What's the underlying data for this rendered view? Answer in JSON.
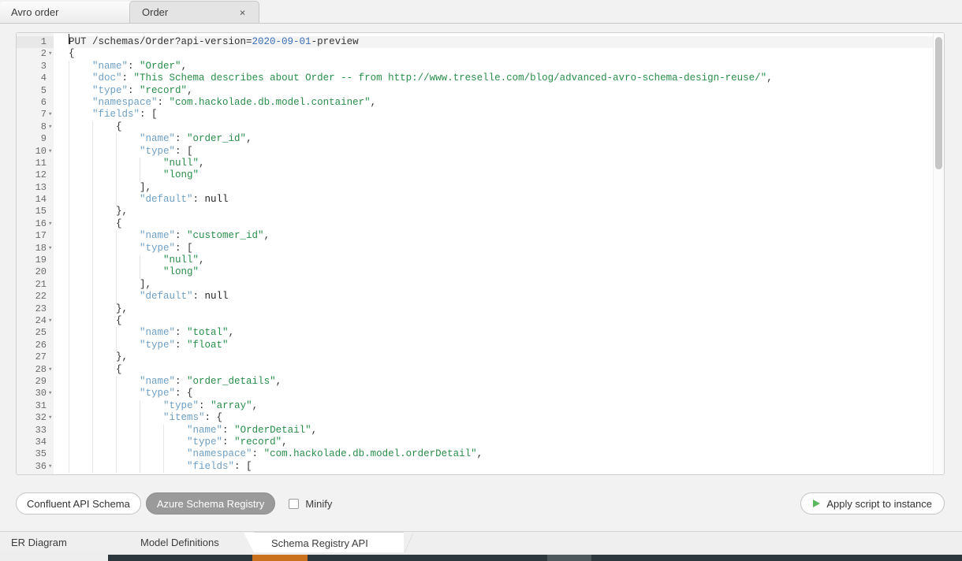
{
  "top_tabs": [
    {
      "label": "Avro order",
      "active": false,
      "closable": false
    },
    {
      "label": "Order",
      "active": true,
      "closable": true,
      "close_glyph": "×"
    }
  ],
  "editor": {
    "language": "json",
    "cursor_line": 1,
    "first_visible_line": 1,
    "lines": [
      {
        "num": "1",
        "fold": "",
        "guides": 0,
        "active": true,
        "tokens": [
          {
            "t": "PUT /schemas/Order?api-version=",
            "c": "p"
          },
          {
            "t": "2020-09-01",
            "c": "n"
          },
          {
            "t": "-preview",
            "c": "p"
          }
        ]
      },
      {
        "num": "2",
        "fold": "▾",
        "guides": 0,
        "tokens": [
          {
            "t": "{",
            "c": "p"
          }
        ]
      },
      {
        "num": "3",
        "fold": "",
        "guides": 1,
        "tokens": [
          {
            "t": "    ",
            "c": "p"
          },
          {
            "t": "\"name\"",
            "c": "k"
          },
          {
            "t": ": ",
            "c": "p"
          },
          {
            "t": "\"Order\"",
            "c": "s"
          },
          {
            "t": ",",
            "c": "p"
          }
        ]
      },
      {
        "num": "4",
        "fold": "",
        "guides": 1,
        "tokens": [
          {
            "t": "    ",
            "c": "p"
          },
          {
            "t": "\"doc\"",
            "c": "k"
          },
          {
            "t": ": ",
            "c": "p"
          },
          {
            "t": "\"This Schema describes about Order -- from http://www.treselle.com/blog/advanced-avro-schema-design-reuse/\"",
            "c": "s"
          },
          {
            "t": ",",
            "c": "p"
          }
        ]
      },
      {
        "num": "5",
        "fold": "",
        "guides": 1,
        "tokens": [
          {
            "t": "    ",
            "c": "p"
          },
          {
            "t": "\"type\"",
            "c": "k"
          },
          {
            "t": ": ",
            "c": "p"
          },
          {
            "t": "\"record\"",
            "c": "s"
          },
          {
            "t": ",",
            "c": "p"
          }
        ]
      },
      {
        "num": "6",
        "fold": "",
        "guides": 1,
        "tokens": [
          {
            "t": "    ",
            "c": "p"
          },
          {
            "t": "\"namespace\"",
            "c": "k"
          },
          {
            "t": ": ",
            "c": "p"
          },
          {
            "t": "\"com.hackolade.db.model.container\"",
            "c": "s"
          },
          {
            "t": ",",
            "c": "p"
          }
        ]
      },
      {
        "num": "7",
        "fold": "▾",
        "guides": 1,
        "tokens": [
          {
            "t": "    ",
            "c": "p"
          },
          {
            "t": "\"fields\"",
            "c": "k"
          },
          {
            "t": ": [",
            "c": "p"
          }
        ]
      },
      {
        "num": "8",
        "fold": "▾",
        "guides": 2,
        "tokens": [
          {
            "t": "        {",
            "c": "p"
          }
        ]
      },
      {
        "num": "9",
        "fold": "",
        "guides": 3,
        "tokens": [
          {
            "t": "            ",
            "c": "p"
          },
          {
            "t": "\"name\"",
            "c": "k"
          },
          {
            "t": ": ",
            "c": "p"
          },
          {
            "t": "\"order_id\"",
            "c": "s"
          },
          {
            "t": ",",
            "c": "p"
          }
        ]
      },
      {
        "num": "10",
        "fold": "▾",
        "guides": 3,
        "tokens": [
          {
            "t": "            ",
            "c": "p"
          },
          {
            "t": "\"type\"",
            "c": "k"
          },
          {
            "t": ": [",
            "c": "p"
          }
        ]
      },
      {
        "num": "11",
        "fold": "",
        "guides": 4,
        "tokens": [
          {
            "t": "                ",
            "c": "p"
          },
          {
            "t": "\"null\"",
            "c": "s"
          },
          {
            "t": ",",
            "c": "p"
          }
        ]
      },
      {
        "num": "12",
        "fold": "",
        "guides": 4,
        "tokens": [
          {
            "t": "                ",
            "c": "p"
          },
          {
            "t": "\"long\"",
            "c": "s"
          }
        ]
      },
      {
        "num": "13",
        "fold": "",
        "guides": 3,
        "tokens": [
          {
            "t": "            ],",
            "c": "p"
          }
        ]
      },
      {
        "num": "14",
        "fold": "",
        "guides": 3,
        "tokens": [
          {
            "t": "            ",
            "c": "p"
          },
          {
            "t": "\"default\"",
            "c": "k"
          },
          {
            "t": ": ",
            "c": "p"
          },
          {
            "t": "null",
            "c": "kw"
          }
        ]
      },
      {
        "num": "15",
        "fold": "",
        "guides": 2,
        "tokens": [
          {
            "t": "        },",
            "c": "p"
          }
        ]
      },
      {
        "num": "16",
        "fold": "▾",
        "guides": 2,
        "tokens": [
          {
            "t": "        {",
            "c": "p"
          }
        ]
      },
      {
        "num": "17",
        "fold": "",
        "guides": 3,
        "tokens": [
          {
            "t": "            ",
            "c": "p"
          },
          {
            "t": "\"name\"",
            "c": "k"
          },
          {
            "t": ": ",
            "c": "p"
          },
          {
            "t": "\"customer_id\"",
            "c": "s"
          },
          {
            "t": ",",
            "c": "p"
          }
        ]
      },
      {
        "num": "18",
        "fold": "▾",
        "guides": 3,
        "tokens": [
          {
            "t": "            ",
            "c": "p"
          },
          {
            "t": "\"type\"",
            "c": "k"
          },
          {
            "t": ": [",
            "c": "p"
          }
        ]
      },
      {
        "num": "19",
        "fold": "",
        "guides": 4,
        "tokens": [
          {
            "t": "                ",
            "c": "p"
          },
          {
            "t": "\"null\"",
            "c": "s"
          },
          {
            "t": ",",
            "c": "p"
          }
        ]
      },
      {
        "num": "20",
        "fold": "",
        "guides": 4,
        "tokens": [
          {
            "t": "                ",
            "c": "p"
          },
          {
            "t": "\"long\"",
            "c": "s"
          }
        ]
      },
      {
        "num": "21",
        "fold": "",
        "guides": 3,
        "tokens": [
          {
            "t": "            ],",
            "c": "p"
          }
        ]
      },
      {
        "num": "22",
        "fold": "",
        "guides": 3,
        "tokens": [
          {
            "t": "            ",
            "c": "p"
          },
          {
            "t": "\"default\"",
            "c": "k"
          },
          {
            "t": ": ",
            "c": "p"
          },
          {
            "t": "null",
            "c": "kw"
          }
        ]
      },
      {
        "num": "23",
        "fold": "",
        "guides": 2,
        "tokens": [
          {
            "t": "        },",
            "c": "p"
          }
        ]
      },
      {
        "num": "24",
        "fold": "▾",
        "guides": 2,
        "tokens": [
          {
            "t": "        {",
            "c": "p"
          }
        ]
      },
      {
        "num": "25",
        "fold": "",
        "guides": 3,
        "tokens": [
          {
            "t": "            ",
            "c": "p"
          },
          {
            "t": "\"name\"",
            "c": "k"
          },
          {
            "t": ": ",
            "c": "p"
          },
          {
            "t": "\"total\"",
            "c": "s"
          },
          {
            "t": ",",
            "c": "p"
          }
        ]
      },
      {
        "num": "26",
        "fold": "",
        "guides": 3,
        "tokens": [
          {
            "t": "            ",
            "c": "p"
          },
          {
            "t": "\"type\"",
            "c": "k"
          },
          {
            "t": ": ",
            "c": "p"
          },
          {
            "t": "\"float\"",
            "c": "s"
          }
        ]
      },
      {
        "num": "27",
        "fold": "",
        "guides": 2,
        "tokens": [
          {
            "t": "        },",
            "c": "p"
          }
        ]
      },
      {
        "num": "28",
        "fold": "▾",
        "guides": 2,
        "tokens": [
          {
            "t": "        {",
            "c": "p"
          }
        ]
      },
      {
        "num": "29",
        "fold": "",
        "guides": 3,
        "tokens": [
          {
            "t": "            ",
            "c": "p"
          },
          {
            "t": "\"name\"",
            "c": "k"
          },
          {
            "t": ": ",
            "c": "p"
          },
          {
            "t": "\"order_details\"",
            "c": "s"
          },
          {
            "t": ",",
            "c": "p"
          }
        ]
      },
      {
        "num": "30",
        "fold": "▾",
        "guides": 3,
        "tokens": [
          {
            "t": "            ",
            "c": "p"
          },
          {
            "t": "\"type\"",
            "c": "k"
          },
          {
            "t": ": {",
            "c": "p"
          }
        ]
      },
      {
        "num": "31",
        "fold": "",
        "guides": 4,
        "tokens": [
          {
            "t": "                ",
            "c": "p"
          },
          {
            "t": "\"type\"",
            "c": "k"
          },
          {
            "t": ": ",
            "c": "p"
          },
          {
            "t": "\"array\"",
            "c": "s"
          },
          {
            "t": ",",
            "c": "p"
          }
        ]
      },
      {
        "num": "32",
        "fold": "▾",
        "guides": 4,
        "tokens": [
          {
            "t": "                ",
            "c": "p"
          },
          {
            "t": "\"items\"",
            "c": "k"
          },
          {
            "t": ": {",
            "c": "p"
          }
        ]
      },
      {
        "num": "33",
        "fold": "",
        "guides": 5,
        "tokens": [
          {
            "t": "                    ",
            "c": "p"
          },
          {
            "t": "\"name\"",
            "c": "k"
          },
          {
            "t": ": ",
            "c": "p"
          },
          {
            "t": "\"OrderDetail\"",
            "c": "s"
          },
          {
            "t": ",",
            "c": "p"
          }
        ]
      },
      {
        "num": "34",
        "fold": "",
        "guides": 5,
        "tokens": [
          {
            "t": "                    ",
            "c": "p"
          },
          {
            "t": "\"type\"",
            "c": "k"
          },
          {
            "t": ": ",
            "c": "p"
          },
          {
            "t": "\"record\"",
            "c": "s"
          },
          {
            "t": ",",
            "c": "p"
          }
        ]
      },
      {
        "num": "35",
        "fold": "",
        "guides": 5,
        "tokens": [
          {
            "t": "                    ",
            "c": "p"
          },
          {
            "t": "\"namespace\"",
            "c": "k"
          },
          {
            "t": ": ",
            "c": "p"
          },
          {
            "t": "\"com.hackolade.db.model.orderDetail\"",
            "c": "s"
          },
          {
            "t": ",",
            "c": "p"
          }
        ]
      },
      {
        "num": "36",
        "fold": "▾",
        "guides": 5,
        "tokens": [
          {
            "t": "                    ",
            "c": "p"
          },
          {
            "t": "\"fields\"",
            "c": "k"
          },
          {
            "t": ": [",
            "c": "p"
          }
        ]
      }
    ]
  },
  "actions": {
    "confluent_label": "Confluent API Schema",
    "azure_label": "Azure Schema Registry",
    "selected_target": "Azure Schema Registry",
    "minify_label": "Minify",
    "minify_checked": false,
    "apply_label": "Apply script to instance"
  },
  "bottom_tabs": [
    {
      "label": "ER Diagram",
      "active": false
    },
    {
      "label": "Model Definitions",
      "active": false
    },
    {
      "label": "Schema Registry API",
      "active": true
    }
  ],
  "colors": {
    "accent_green": "#5cb85c",
    "active_button": "#9a9a9a",
    "json_key": "#6e9fc4",
    "json_string": "#298d4a",
    "json_number": "#3a6fb5",
    "taskbar_dark": "#2b373c",
    "taskbar_orange": "#c9711d"
  }
}
